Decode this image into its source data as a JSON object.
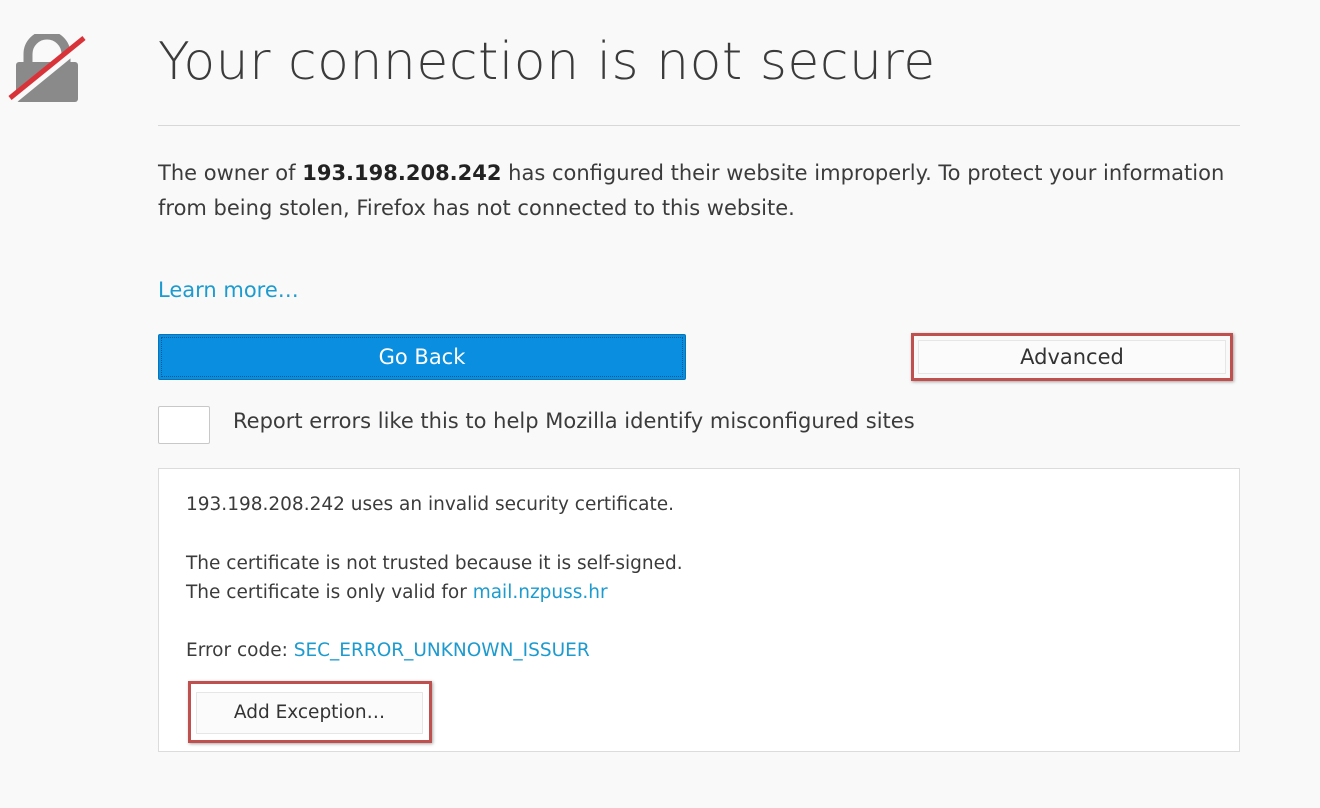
{
  "page": {
    "title": "Your connection is not secure",
    "intro": {
      "prefix": "The owner of ",
      "host": "193.198.208.242",
      "suffix": " has configured their website improperly. To protect your information from being stolen, Firefox has not connected to this website."
    },
    "learn_more": "Learn more…"
  },
  "buttons": {
    "go_back": "Go Back",
    "advanced": "Advanced",
    "add_exception": "Add Exception…"
  },
  "report": {
    "label": "Report errors like this to help Mozilla identify misconfigured sites",
    "checked": false
  },
  "details": {
    "invalid_cert": "193.198.208.242 uses an invalid security certificate.",
    "not_trusted": "The certificate is not trusted because it is self-signed.",
    "valid_for_prefix": "The certificate is only valid for ",
    "valid_for_host": "mail.nzpuss.hr",
    "error_code_prefix": "Error code: ",
    "error_code": "SEC_ERROR_UNKNOWN_ISSUER"
  },
  "icons": {
    "warning": "broken-lock-icon"
  },
  "colors": {
    "accent": "#0a8ee0",
    "link": "#1d9bcf",
    "highlight": "#c0504d",
    "strike": "#d9333a"
  }
}
